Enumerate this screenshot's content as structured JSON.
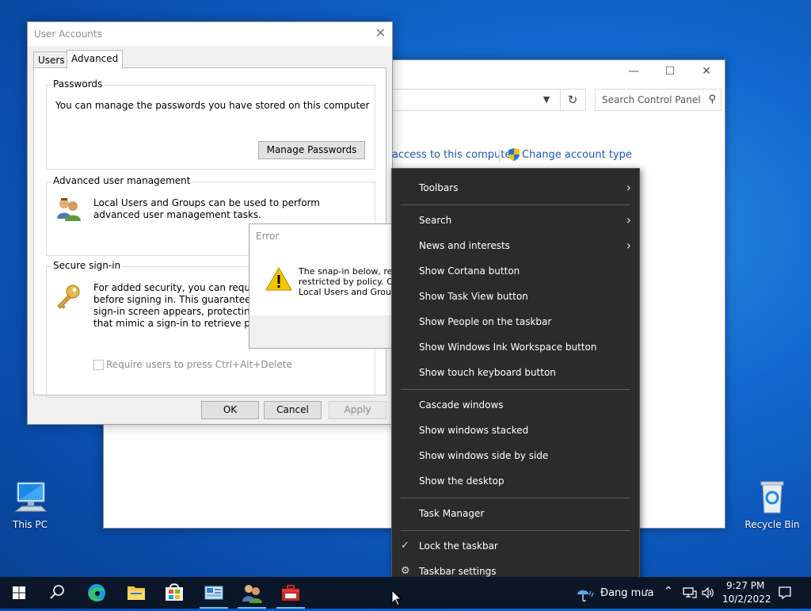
{
  "desktop": {
    "icons": [
      {
        "label": "This PC",
        "icon": "computer-icon"
      },
      {
        "label": "Recycle Bin",
        "icon": "recycle-bin-icon"
      }
    ]
  },
  "control_panel": {
    "search_placeholder": "Search Control Panel",
    "link_access": "access to this computer",
    "link_change_account": "Change account type"
  },
  "user_accounts": {
    "title": "User Accounts",
    "tabs": [
      {
        "label": "Users"
      },
      {
        "label": "Advanced",
        "active": true
      }
    ],
    "passwords": {
      "title": "Passwords",
      "text": "You can manage the passwords you have stored on this computer",
      "button": "Manage Passwords"
    },
    "advanced_mgmt": {
      "title": "Advanced user management",
      "text": "Local Users and Groups can be used to perform advanced user management tasks."
    },
    "secure_signin": {
      "title": "Secure sign-in",
      "lines": [
        "For added security, you can require us",
        "before signing in. This guarantees that",
        "sign-in screen appears, protecting the",
        "that mimic a sign-in to retrieve passw"
      ],
      "checkbox_label": "Require users to press Ctrl+Alt+Delete",
      "checkbox_checked": false
    },
    "buttons": {
      "ok": "OK",
      "cancel": "Cancel",
      "apply": "Apply"
    }
  },
  "error_dialog": {
    "title": "Error",
    "lines": [
      "The snap-in below, ref",
      "restricted by policy. Co",
      "Local Users and Group"
    ]
  },
  "context_menu": {
    "items": [
      {
        "label": "Toolbars",
        "submenu": true
      },
      {
        "label": "Search",
        "submenu": true
      },
      {
        "label": "News and interests",
        "submenu": true
      },
      {
        "label": "Show Cortana button"
      },
      {
        "label": "Show Task View button"
      },
      {
        "label": "Show People on the taskbar"
      },
      {
        "label": "Show Windows Ink Workspace button"
      },
      {
        "label": "Show touch keyboard button"
      },
      {
        "label": "Cascade windows"
      },
      {
        "label": "Show windows stacked"
      },
      {
        "label": "Show windows side by side"
      },
      {
        "label": "Show the desktop"
      },
      {
        "label": "Task Manager"
      },
      {
        "label": "Lock the taskbar",
        "checked": true
      },
      {
        "label": "Taskbar settings",
        "icon": "gear-icon"
      }
    ]
  },
  "taskbar": {
    "weather": "Đang mưa",
    "time": "9:27 PM",
    "date": "10/2/2022"
  }
}
